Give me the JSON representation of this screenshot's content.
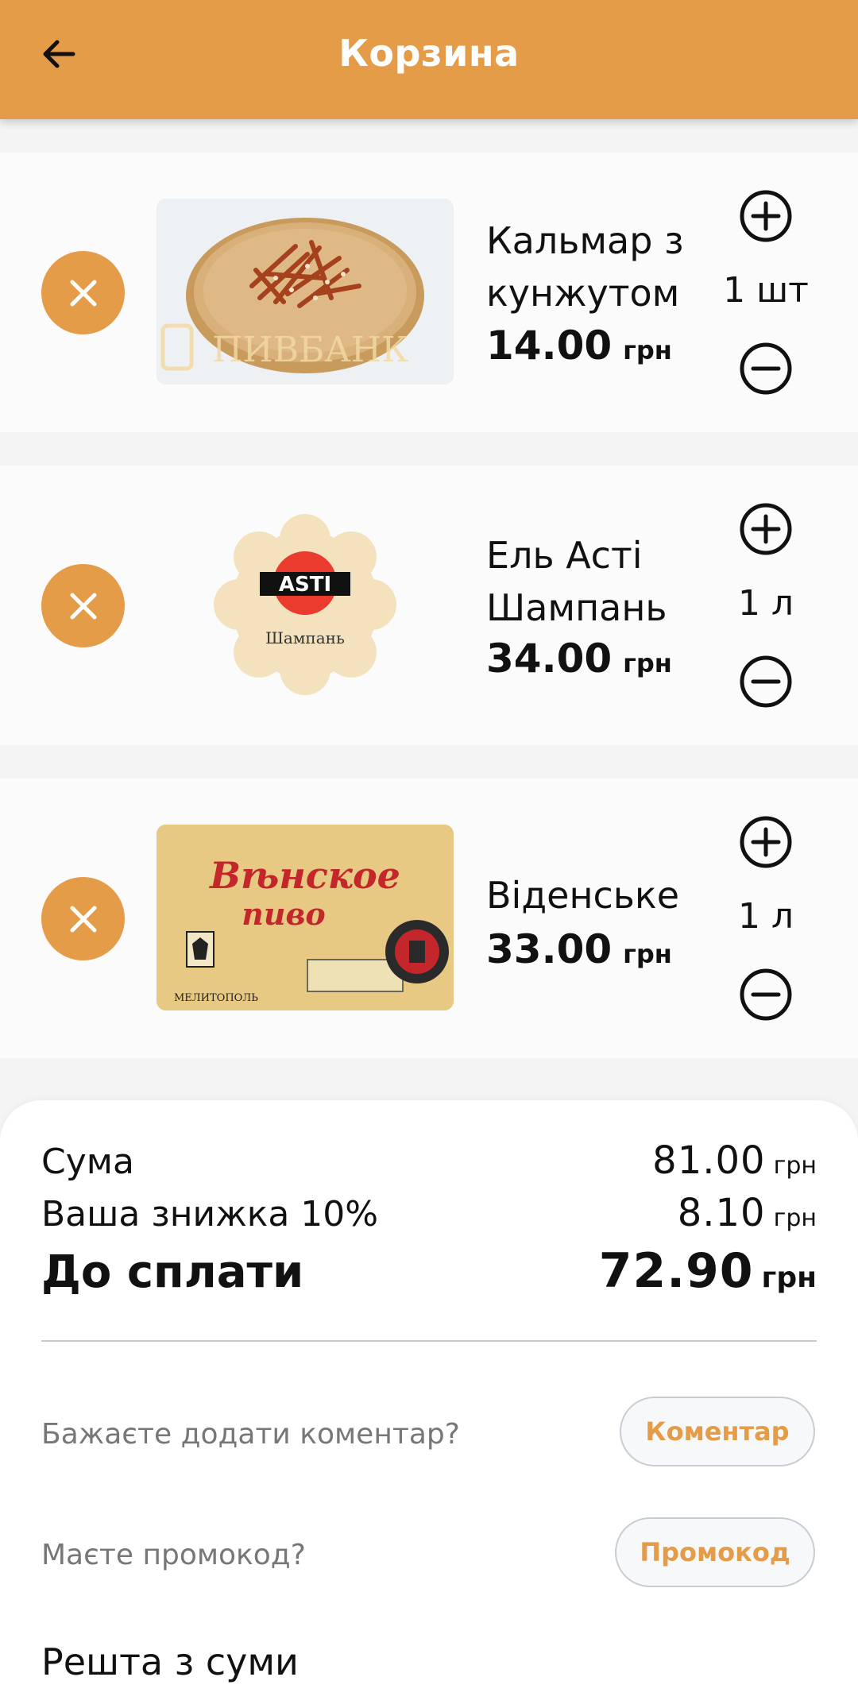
{
  "header": {
    "title": "Корзина",
    "back_icon": "arrow-left-icon"
  },
  "cart": {
    "items": [
      {
        "name_line1": "Кальмар з",
        "name_line2": "кунжутом",
        "price": "14.00",
        "currency": "грн",
        "quantity": "1 шт",
        "image": "squid-with-sesame-on-wooden-board",
        "watermark": "ПИВБАНК"
      },
      {
        "name_line1": "Ель Асті",
        "name_line2": "Шампань",
        "price": "34.00",
        "currency": "грн",
        "quantity": "1 л",
        "image": "asti-champagne-logo",
        "logo_text": "ASTI",
        "logo_sub": "Шампань"
      },
      {
        "name_line1": "Віденське",
        "name_line2": "",
        "price": "33.00",
        "currency": "грн",
        "quantity": "1 л",
        "image": "vienna-beer-label",
        "label_line1": "Вѣнское",
        "label_line2": "пиво",
        "label_city": "МЕЛИТОПОЛЬ"
      }
    ]
  },
  "summary": {
    "sum_label": "Сума",
    "sum_value": "81.00",
    "discount_label": "Ваша знижка 10%",
    "discount_value": "8.10",
    "total_label": "До сплати",
    "total_value": "72.90",
    "currency": "грн",
    "comment_prompt": "Бажаєте додати коментар?",
    "comment_button": "Коментар",
    "promo_prompt": "Маєте промокод?",
    "promo_button": "Промокод",
    "change_label": "Решта з суми"
  },
  "colors": {
    "accent": "#e59c48",
    "background": "#f4f4f4",
    "card": "#fbfbfb"
  }
}
